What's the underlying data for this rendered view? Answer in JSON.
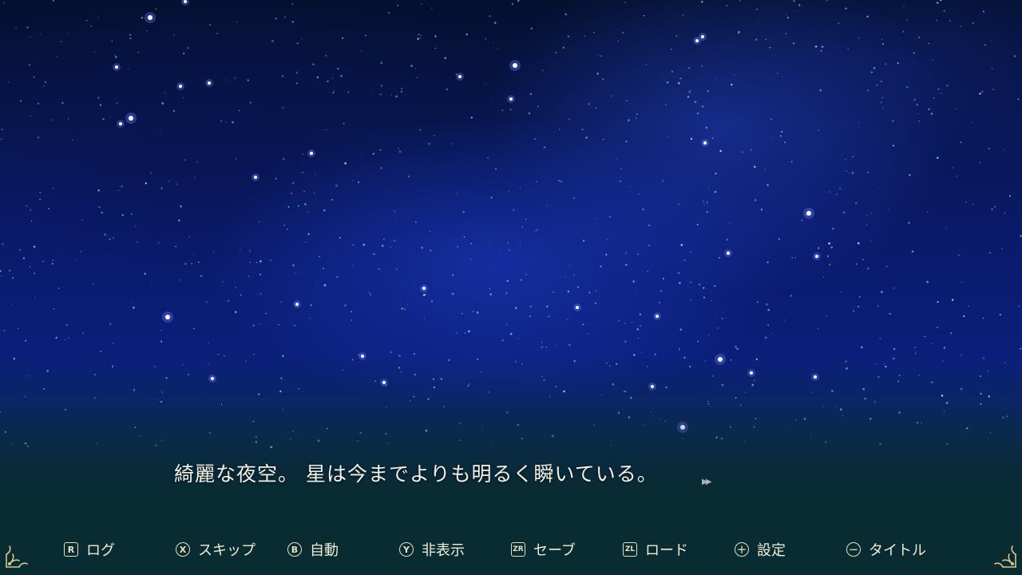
{
  "dialogue": {
    "text": "綺麗な夜空。 星は今までよりも明るく瞬いている。",
    "advance_icon": "▶▶"
  },
  "menu": {
    "items": [
      {
        "key": "log",
        "glyph": "R",
        "glyph_shape": "square",
        "label": "ログ"
      },
      {
        "key": "skip",
        "glyph": "X",
        "glyph_shape": "circle",
        "label": "スキップ"
      },
      {
        "key": "auto",
        "glyph": "B",
        "glyph_shape": "circle",
        "label": "自動"
      },
      {
        "key": "hide",
        "glyph": "Y",
        "glyph_shape": "circle",
        "label": "非表示"
      },
      {
        "key": "save",
        "glyph": "ZR",
        "glyph_shape": "square",
        "label": "セーブ"
      },
      {
        "key": "load",
        "glyph": "ZL",
        "glyph_shape": "square",
        "label": "ロード"
      },
      {
        "key": "settings",
        "glyph": "+",
        "glyph_shape": "circle",
        "label": "設定"
      },
      {
        "key": "title",
        "glyph": "−",
        "glyph_shape": "circle",
        "label": "タイトル"
      }
    ]
  },
  "colors": {
    "text": "#f3f1e6",
    "menu_text": "#f1ecd5",
    "ornament": "#d8c98a",
    "sky_top": "#04102e",
    "sky_mid": "#0b1f7a",
    "horizon": "#0a2a2e"
  },
  "icons": {
    "corner_left": "ornament-corner-icon",
    "corner_right": "ornament-corner-icon"
  }
}
